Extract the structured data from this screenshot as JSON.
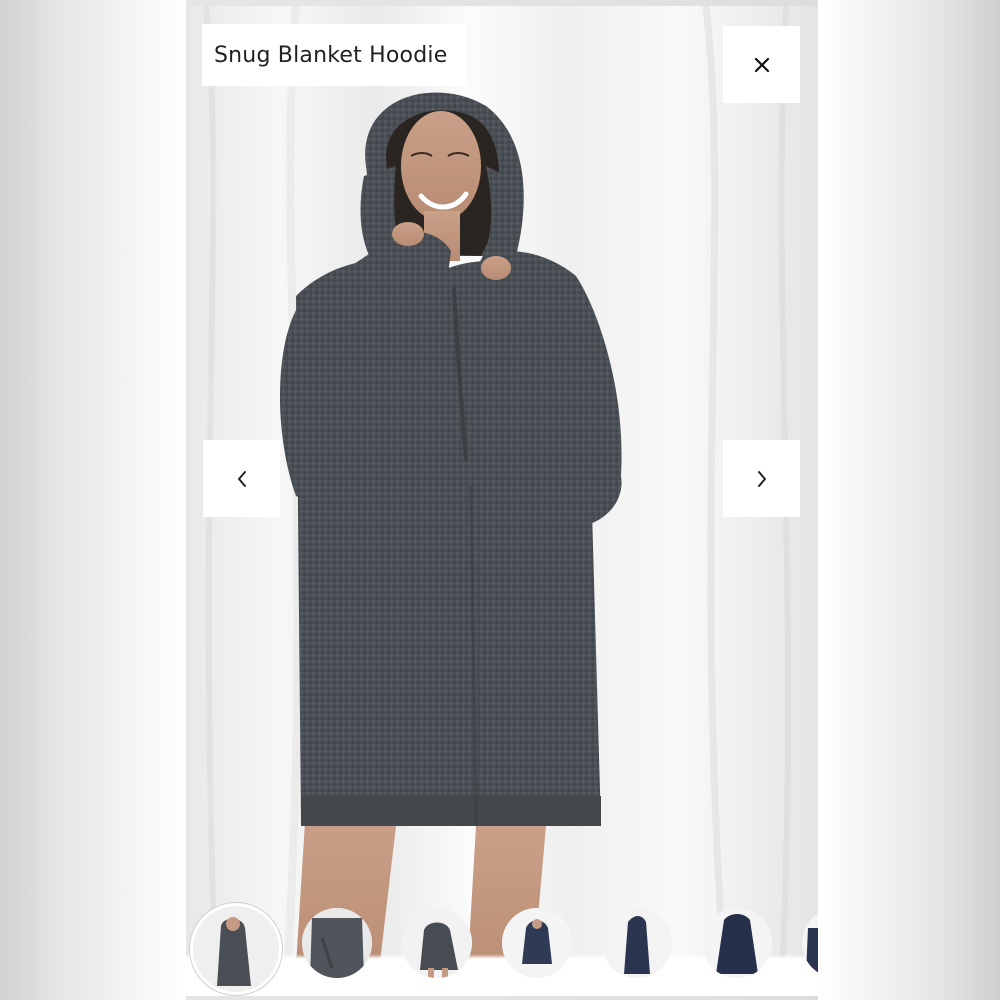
{
  "viewer": {
    "title": "Snug Blanket Hoodie"
  },
  "icons": {
    "close": "close-icon",
    "prev": "chevron-left-icon",
    "next": "chevron-right-icon"
  },
  "colors": {
    "hoodie": "#4a4f55",
    "backdrop": "#f2f2f2",
    "button_bg": "#ffffff",
    "text": "#222222"
  },
  "thumbnails": {
    "count": 7,
    "selected_index": 0
  }
}
